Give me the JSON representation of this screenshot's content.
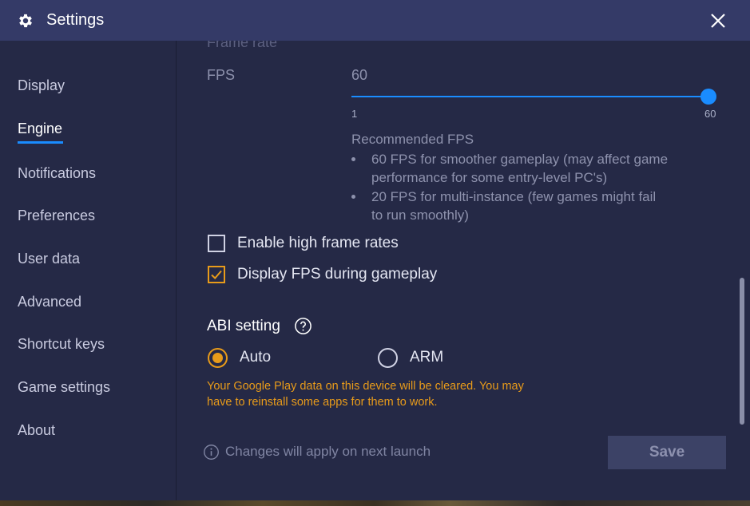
{
  "window": {
    "title": "Settings"
  },
  "sidebar": {
    "items": [
      {
        "label": "Display"
      },
      {
        "label": "Engine"
      },
      {
        "label": "Notifications"
      },
      {
        "label": "Preferences"
      },
      {
        "label": "User data"
      },
      {
        "label": "Advanced"
      },
      {
        "label": "Shortcut keys"
      },
      {
        "label": "Game settings"
      },
      {
        "label": "About"
      }
    ],
    "active": "Engine"
  },
  "main": {
    "section_heading_cut": "Frame rate",
    "fps": {
      "label": "FPS",
      "value": "60",
      "min_label": "1",
      "max_label": "60",
      "slider_min": 1,
      "slider_max": 60,
      "slider_value": 60
    },
    "recommended": {
      "title": "Recommended FPS",
      "items": [
        "60 FPS for smoother gameplay (may affect game performance for some entry-level PC's)",
        "20 FPS for multi-instance (few games might fail to run smoothly)"
      ]
    },
    "checkboxes": [
      {
        "label": "Enable high frame rates",
        "checked": false
      },
      {
        "label": "Display FPS during gameplay",
        "checked": true
      }
    ],
    "abi": {
      "title": "ABI setting",
      "options": [
        {
          "label": "Auto",
          "selected": true
        },
        {
          "label": "ARM",
          "selected": false
        }
      ],
      "warning": "Your Google Play data on this device will be cleared. You may have to reinstall some apps for them to work."
    },
    "footer": {
      "info_text": "Changes will apply on next launch",
      "save_label": "Save"
    }
  },
  "colors": {
    "background": "#252946",
    "titlebar": "#343a67",
    "accent_blue": "#1a8cff",
    "accent_orange": "#e89b1a",
    "save_button_bg": "#3c4266"
  },
  "icons": [
    "gear-icon",
    "close-icon",
    "help-icon",
    "info-icon",
    "check-icon"
  ]
}
